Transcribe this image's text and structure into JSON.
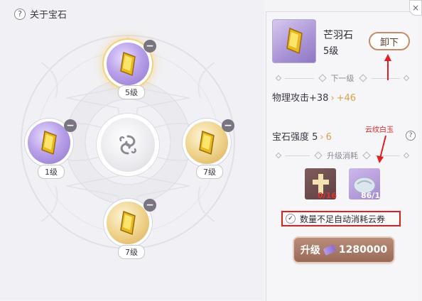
{
  "header": {
    "help_icon_text": "?",
    "title": "关于宝石"
  },
  "slots": [
    {
      "level": "5级",
      "color": "purple",
      "selected": true
    },
    {
      "level": "1级",
      "color": "purple",
      "selected": false
    },
    {
      "level": "7级",
      "color": "gold",
      "selected": false
    },
    {
      "level": "7级",
      "color": "gold",
      "selected": false
    }
  ],
  "slot_remove_symbol": "−",
  "panel": {
    "close_symbol": "×",
    "gem_name": "芒羽石",
    "gem_level": "5级",
    "unequip_label": "卸下",
    "next_level_label": "下一级",
    "attack_stat": {
      "label": "物理攻击+38",
      "arrow": "›",
      "next": "+46"
    },
    "strength_stat": {
      "label": "宝石强度 5",
      "arrow": "›",
      "next": "6"
    },
    "strength_help": "?",
    "annotation": "云纹白玉",
    "cost_label": "升级消耗",
    "materials": [
      {
        "count": "0/16",
        "count_color": "#e0342c"
      },
      {
        "count": "86/1",
        "count_color": "#ffffff"
      }
    ],
    "auto_consume_label": "数量不足自动消耗云券",
    "auto_consume_checked": true,
    "check_symbol": "✓",
    "upgrade_label": "升级",
    "upgrade_cost": "1280000"
  },
  "colors": {
    "annotation_red": "#e02020",
    "gold_accent": "#d8a24c",
    "button_brown": "#9a6a58"
  }
}
